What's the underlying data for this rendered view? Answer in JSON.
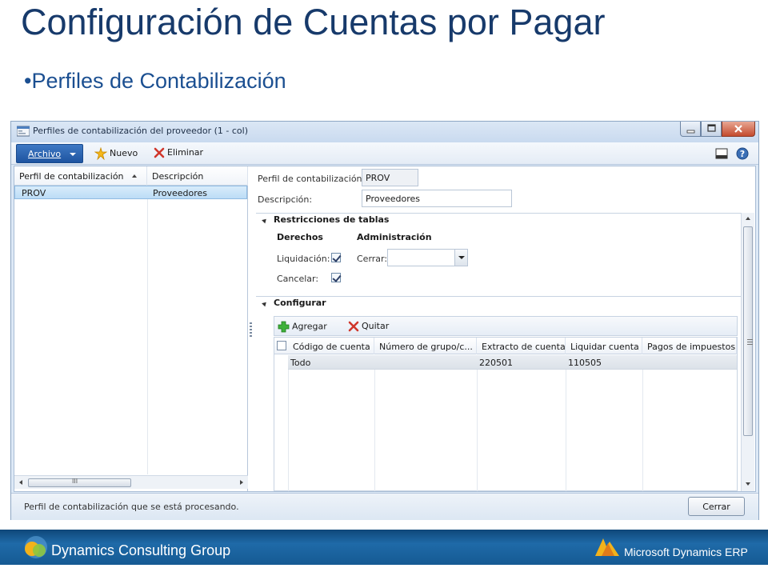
{
  "slide": {
    "title": "Configuración de Cuentas por Pagar",
    "bullet": "•Perfiles de Contabilización"
  },
  "window": {
    "title": "Perfiles de contabilización del proveedor (1 - col)"
  },
  "toolbar": {
    "archivo": "Archivo",
    "nuevo": "Nuevo",
    "eliminar": "Eliminar"
  },
  "list": {
    "headers": [
      "Perfil de contabilización",
      "Descripción"
    ],
    "rows": [
      {
        "perfil": "PROV",
        "descripcion": "Proveedores"
      }
    ],
    "scroll_glyph": "III"
  },
  "detail": {
    "perfil_label": "Perfil de contabilización:",
    "perfil_value": "PROV",
    "descripcion_label": "Descripción:",
    "descripcion_value": "Proveedores",
    "restricciones": {
      "title": "Restricciones de tablas",
      "derechos": "Derechos",
      "administracion": "Administración",
      "liquidacion_label": "Liquidación:",
      "liquidacion_checked": true,
      "cancelar_label": "Cancelar:",
      "cancelar_checked": true,
      "cerrar_label": "Cerrar:",
      "cerrar_value": ""
    },
    "configurar": {
      "title": "Configurar",
      "agregar": "Agregar",
      "quitar": "Quitar",
      "headers": [
        "Código de cuenta",
        "Número de grupo/c...",
        "Extracto de cuenta",
        "Liquidar cuenta",
        "Pagos de impuestos"
      ],
      "rows": [
        {
          "codigo": "Todo",
          "grupo": "",
          "extracto": "220501",
          "liquidar": "110505",
          "pagos": ""
        }
      ]
    }
  },
  "status": {
    "text": "Perfil de contabilización que se está procesando.",
    "close_button": "Cerrar"
  },
  "footer": {
    "left": "Dynamics Consulting Group",
    "right": "Microsoft Dynamics ERP"
  },
  "colors": {
    "title": "#173a6b",
    "bullet": "#1b4f91",
    "archivo": "#1e54a0",
    "footer": "#1f6aa8"
  }
}
